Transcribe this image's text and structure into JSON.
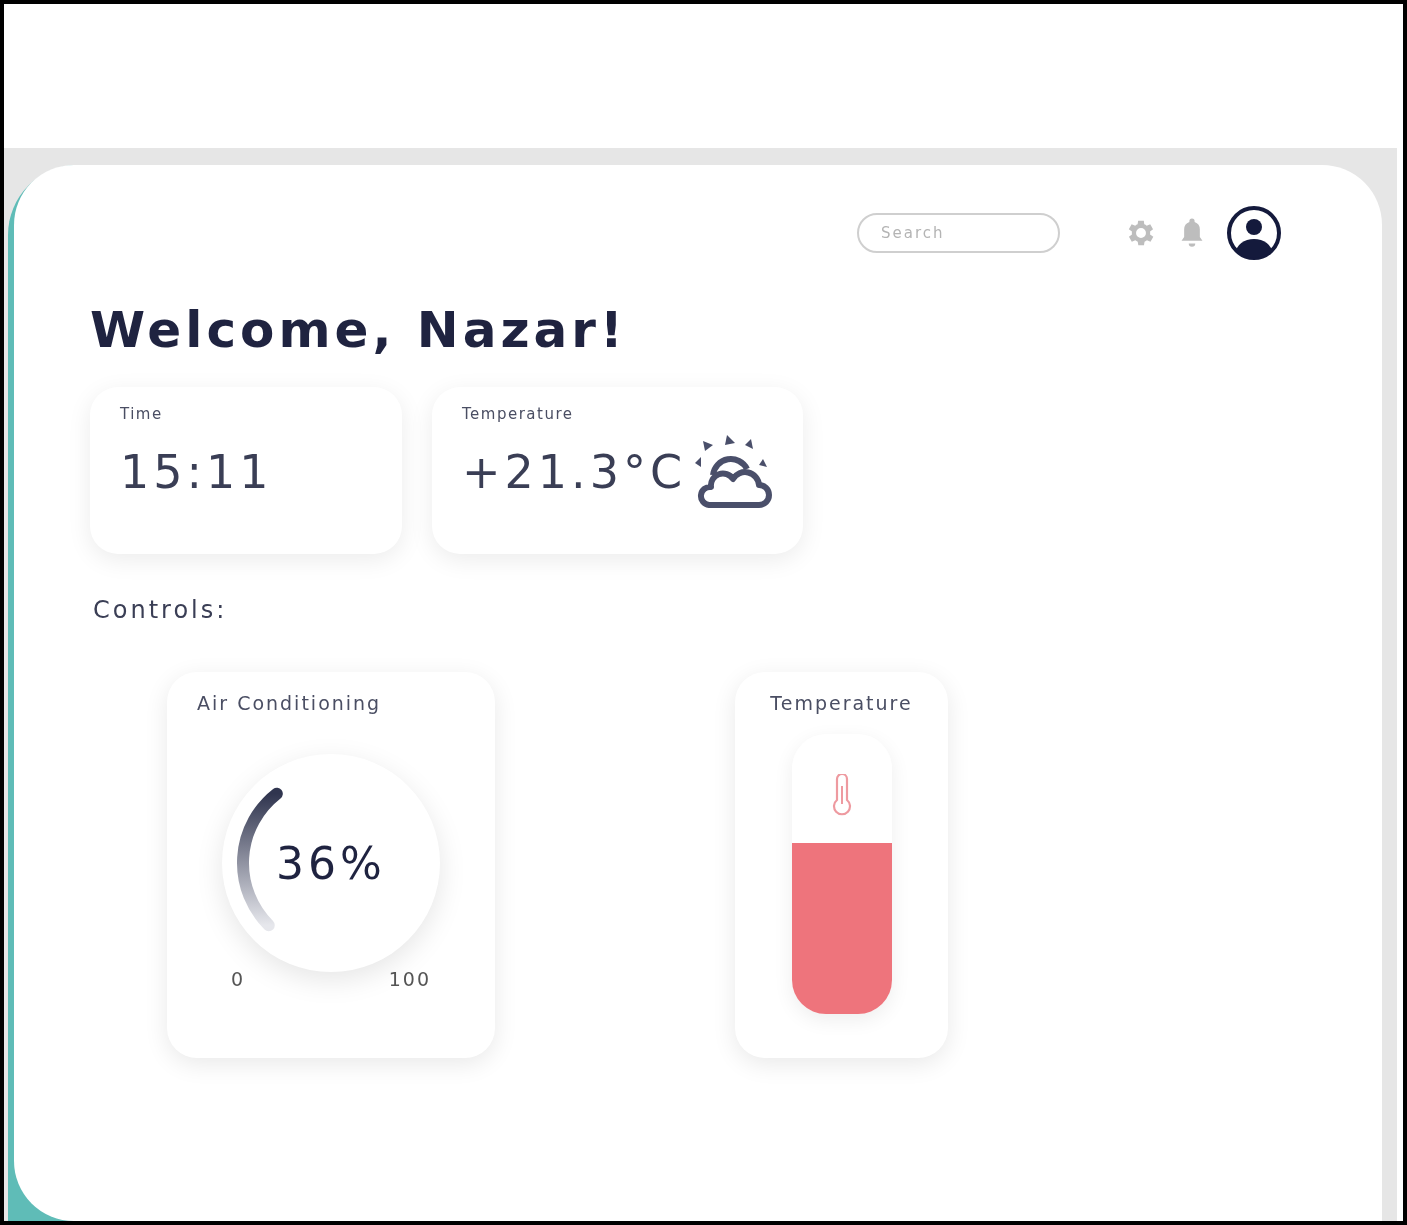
{
  "search": {
    "placeholder": "Search"
  },
  "greeting": "Welcome, Nazar!",
  "stats": [
    {
      "kind": "time",
      "label": "Time",
      "value": "15:11"
    },
    {
      "kind": "weather",
      "label": "Temperature",
      "value": "+21.3°C"
    }
  ],
  "controls_heading": "Controls:",
  "controls": [
    {
      "kind": "dial",
      "title": "Air Conditioning",
      "value": "36%",
      "min_label": "0",
      "max_label": "100"
    },
    {
      "kind": "thermo",
      "title": "Temperature",
      "level": 0.61
    }
  ]
}
